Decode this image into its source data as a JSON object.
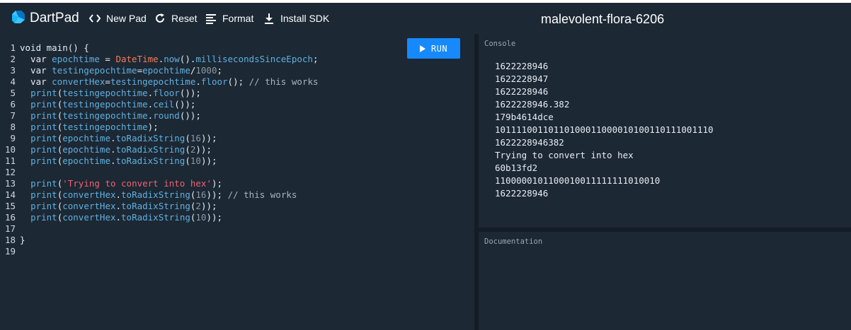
{
  "header": {
    "brand": "DartPad",
    "toolbar": {
      "new_pad": "New Pad",
      "reset": "Reset",
      "format": "Format",
      "install_sdk": "Install SDK"
    },
    "pad_title": "malevolent-flora-6206"
  },
  "editor": {
    "run_label": "RUN",
    "lines": [
      [
        {
          "t": "void main() {",
          "c": "kw"
        }
      ],
      [
        {
          "t": "  var ",
          "c": "kw"
        },
        {
          "t": "epochtime",
          "c": "id"
        },
        {
          "t": " = ",
          "c": "kw"
        },
        {
          "t": "DateTime",
          "c": "cls"
        },
        {
          "t": ".",
          "c": "kw"
        },
        {
          "t": "now",
          "c": "fn"
        },
        {
          "t": "().",
          "c": "kw"
        },
        {
          "t": "millisecondsSinceEpoch",
          "c": "fn"
        },
        {
          "t": ";",
          "c": "kw"
        }
      ],
      [
        {
          "t": "  var ",
          "c": "kw"
        },
        {
          "t": "testingepochtime",
          "c": "id"
        },
        {
          "t": "=",
          "c": "kw"
        },
        {
          "t": "epochtime",
          "c": "id"
        },
        {
          "t": "/",
          "c": "kw"
        },
        {
          "t": "1000",
          "c": "num"
        },
        {
          "t": ";",
          "c": "kw"
        }
      ],
      [
        {
          "t": "  var ",
          "c": "kw"
        },
        {
          "t": "convertHex",
          "c": "id"
        },
        {
          "t": "=",
          "c": "kw"
        },
        {
          "t": "testingepochtime",
          "c": "id"
        },
        {
          "t": ".",
          "c": "kw"
        },
        {
          "t": "floor",
          "c": "fn"
        },
        {
          "t": "(); ",
          "c": "kw"
        },
        {
          "t": "// this works",
          "c": "cmt"
        }
      ],
      [
        {
          "t": "  ",
          "c": "kw"
        },
        {
          "t": "print",
          "c": "fn"
        },
        {
          "t": "(",
          "c": "kw"
        },
        {
          "t": "testingepochtime",
          "c": "id"
        },
        {
          "t": ".",
          "c": "kw"
        },
        {
          "t": "floor",
          "c": "fn"
        },
        {
          "t": "());",
          "c": "kw"
        }
      ],
      [
        {
          "t": "  ",
          "c": "kw"
        },
        {
          "t": "print",
          "c": "fn"
        },
        {
          "t": "(",
          "c": "kw"
        },
        {
          "t": "testingepochtime",
          "c": "id"
        },
        {
          "t": ".",
          "c": "kw"
        },
        {
          "t": "ceil",
          "c": "fn"
        },
        {
          "t": "());",
          "c": "kw"
        }
      ],
      [
        {
          "t": "  ",
          "c": "kw"
        },
        {
          "t": "print",
          "c": "fn"
        },
        {
          "t": "(",
          "c": "kw"
        },
        {
          "t": "testingepochtime",
          "c": "id"
        },
        {
          "t": ".",
          "c": "kw"
        },
        {
          "t": "round",
          "c": "fn"
        },
        {
          "t": "());",
          "c": "kw"
        }
      ],
      [
        {
          "t": "  ",
          "c": "kw"
        },
        {
          "t": "print",
          "c": "fn"
        },
        {
          "t": "(",
          "c": "kw"
        },
        {
          "t": "testingepochtime",
          "c": "id"
        },
        {
          "t": ");",
          "c": "kw"
        }
      ],
      [
        {
          "t": "  ",
          "c": "kw"
        },
        {
          "t": "print",
          "c": "fn"
        },
        {
          "t": "(",
          "c": "kw"
        },
        {
          "t": "epochtime",
          "c": "id"
        },
        {
          "t": ".",
          "c": "kw"
        },
        {
          "t": "toRadixString",
          "c": "fn"
        },
        {
          "t": "(",
          "c": "kw"
        },
        {
          "t": "16",
          "c": "num"
        },
        {
          "t": "));",
          "c": "kw"
        }
      ],
      [
        {
          "t": "  ",
          "c": "kw"
        },
        {
          "t": "print",
          "c": "fn"
        },
        {
          "t": "(",
          "c": "kw"
        },
        {
          "t": "epochtime",
          "c": "id"
        },
        {
          "t": ".",
          "c": "kw"
        },
        {
          "t": "toRadixString",
          "c": "fn"
        },
        {
          "t": "(",
          "c": "kw"
        },
        {
          "t": "2",
          "c": "num"
        },
        {
          "t": "));",
          "c": "kw"
        }
      ],
      [
        {
          "t": "  ",
          "c": "kw"
        },
        {
          "t": "print",
          "c": "fn"
        },
        {
          "t": "(",
          "c": "kw"
        },
        {
          "t": "epochtime",
          "c": "id"
        },
        {
          "t": ".",
          "c": "kw"
        },
        {
          "t": "toRadixString",
          "c": "fn"
        },
        {
          "t": "(",
          "c": "kw"
        },
        {
          "t": "10",
          "c": "num"
        },
        {
          "t": "));",
          "c": "kw"
        }
      ],
      [],
      [
        {
          "t": "  ",
          "c": "kw"
        },
        {
          "t": "print",
          "c": "fn"
        },
        {
          "t": "(",
          "c": "kw"
        },
        {
          "t": "'Trying to convert into hex'",
          "c": "str"
        },
        {
          "t": ");",
          "c": "kw"
        }
      ],
      [
        {
          "t": "  ",
          "c": "kw"
        },
        {
          "t": "print",
          "c": "fn"
        },
        {
          "t": "(",
          "c": "kw"
        },
        {
          "t": "convertHex",
          "c": "id"
        },
        {
          "t": ".",
          "c": "kw"
        },
        {
          "t": "toRadixString",
          "c": "fn"
        },
        {
          "t": "(",
          "c": "kw"
        },
        {
          "t": "16",
          "c": "num"
        },
        {
          "t": ")); ",
          "c": "kw"
        },
        {
          "t": "// this works",
          "c": "cmt"
        }
      ],
      [
        {
          "t": "  ",
          "c": "kw"
        },
        {
          "t": "print",
          "c": "fn"
        },
        {
          "t": "(",
          "c": "kw"
        },
        {
          "t": "convertHex",
          "c": "id"
        },
        {
          "t": ".",
          "c": "kw"
        },
        {
          "t": "toRadixString",
          "c": "fn"
        },
        {
          "t": "(",
          "c": "kw"
        },
        {
          "t": "2",
          "c": "num"
        },
        {
          "t": "));",
          "c": "kw"
        }
      ],
      [
        {
          "t": "  ",
          "c": "kw"
        },
        {
          "t": "print",
          "c": "fn"
        },
        {
          "t": "(",
          "c": "kw"
        },
        {
          "t": "convertHex",
          "c": "id"
        },
        {
          "t": ".",
          "c": "kw"
        },
        {
          "t": "toRadixString",
          "c": "fn"
        },
        {
          "t": "(",
          "c": "kw"
        },
        {
          "t": "10",
          "c": "num"
        },
        {
          "t": "));",
          "c": "kw"
        }
      ],
      [],
      [
        {
          "t": "}",
          "c": "kw"
        }
      ],
      []
    ]
  },
  "console": {
    "label": "Console",
    "lines": [
      "1622228946",
      "1622228947",
      "1622228946",
      "1622228946.382",
      "179b4614dce",
      "10111100110110100011000010100110111001110",
      "1622228946382",
      "Trying to convert into hex",
      "60b13fd2",
      "1100000101100010011111111010010",
      "1622228946"
    ]
  },
  "documentation": {
    "label": "Documentation"
  },
  "colors": {
    "background": "#1c2834",
    "accent": "#168afd",
    "string": "#f06070",
    "class": "#f57d56",
    "identifier": "#5fb1e0"
  }
}
